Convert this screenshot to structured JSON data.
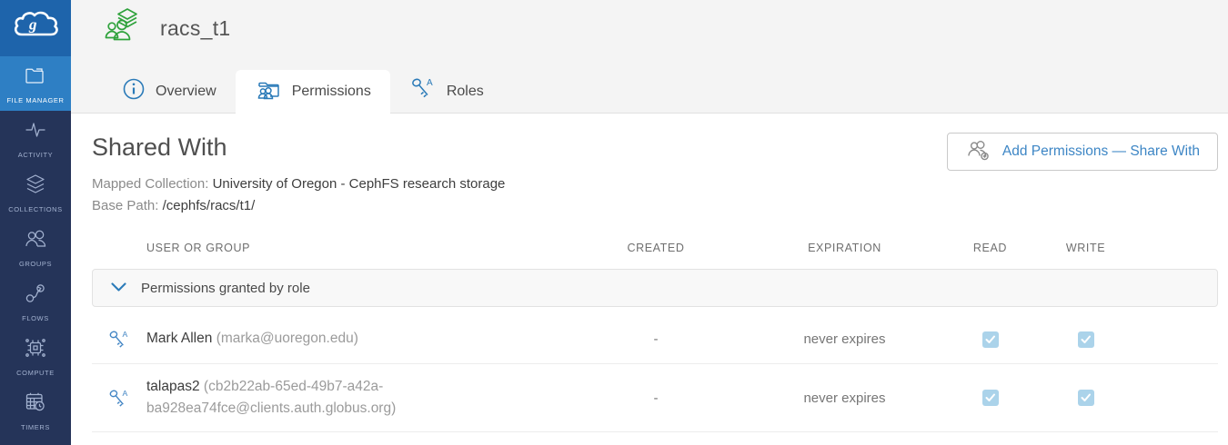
{
  "sidebar": {
    "items": [
      {
        "label": "FILE MANAGER",
        "icon": "folder-icon",
        "active": true
      },
      {
        "label": "ACTIVITY",
        "icon": "pulse-icon",
        "active": false
      },
      {
        "label": "COLLECTIONS",
        "icon": "layers-icon",
        "active": false
      },
      {
        "label": "GROUPS",
        "icon": "people-icon",
        "active": false
      },
      {
        "label": "FLOWS",
        "icon": "flow-icon",
        "active": false
      },
      {
        "label": "COMPUTE",
        "icon": "chip-icon",
        "active": false
      },
      {
        "label": "TIMERS",
        "icon": "calendar-clock-icon",
        "active": false
      }
    ]
  },
  "header": {
    "title": "racs_t1",
    "icon": "guest-collection-icon"
  },
  "tabs": [
    {
      "label": "Overview",
      "icon": "info-circle-icon",
      "active": false
    },
    {
      "label": "Permissions",
      "icon": "folder-people-icon",
      "active": true
    },
    {
      "label": "Roles",
      "icon": "key-icon",
      "active": false
    }
  ],
  "main": {
    "section_title": "Shared With",
    "mapped_collection_label": "Mapped Collection:",
    "mapped_collection_value": "University of Oregon - CephFS research storage",
    "base_path_label": "Base Path:",
    "base_path_value": "/cephfs/racs/t1/",
    "add_permissions_button": "Add Permissions — Share With",
    "table": {
      "columns": [
        "USER OR GROUP",
        "CREATED",
        "EXPIRATION",
        "READ",
        "WRITE"
      ],
      "group_row_label": "Permissions granted by role",
      "rows": [
        {
          "name": "Mark Allen",
          "identity": "(marka@uoregon.edu)",
          "created": "-",
          "expiration": "never expires",
          "read": true,
          "write": true
        },
        {
          "name": "talapas2",
          "identity": "(cb2b22ab-65ed-49b7-a42a-ba928ea74fce@clients.auth.globus.org)",
          "created": "-",
          "expiration": "never expires",
          "read": true,
          "write": true
        }
      ]
    }
  },
  "colors": {
    "sidebar_navy": "#253459",
    "logo_blue": "#1e64ab",
    "active_tile_blue": "#2e7fc4",
    "accent_blue": "#2a7ab8",
    "link_blue": "#3d86c5",
    "collection_green": "#2fa23c",
    "checkbox_blue": "#abd3ea",
    "header_gray": "#f4f4f4"
  }
}
